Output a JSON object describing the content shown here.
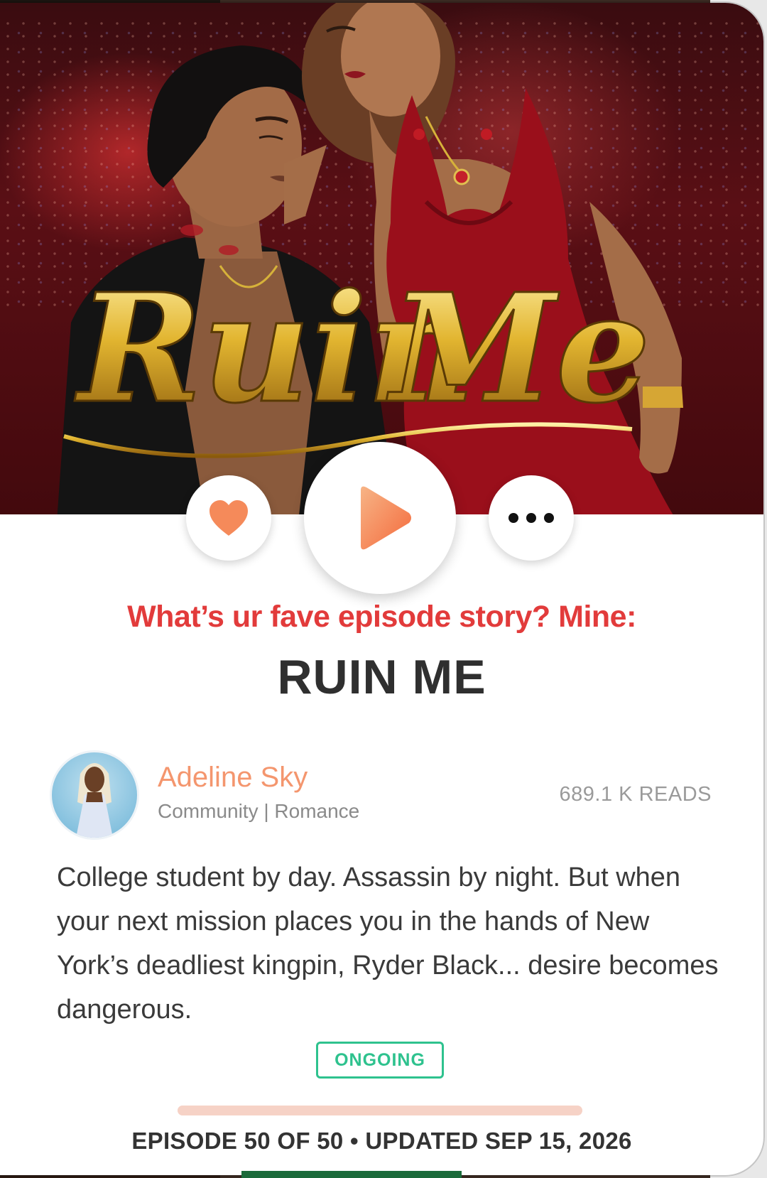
{
  "cover": {
    "title_art_text_1": "Ruin",
    "title_art_text_2": "Me"
  },
  "actions": {
    "like_icon": "heart-icon",
    "play_icon": "play-icon",
    "more_icon": "more-dots-icon"
  },
  "promo_text": "What’s ur fave episode story? Mine:",
  "story": {
    "title": "RUIN ME",
    "author": "Adeline Sky",
    "category": "Community | Romance",
    "reads": "689.1 K READS",
    "description": "College student by day. Assassin by night. But when your next mission places you in the hands of New York’s deadliest kingpin, Ryder Black... desire becomes dangerous.",
    "status": "ONGOING",
    "progress": 1.0,
    "episode_info": "EPISODE 50 OF 50 • UPDATED SEP 15, 2026"
  },
  "colors": {
    "accent": "#f4966e",
    "promo": "#e23b3b",
    "status": "#2ec28e",
    "title": "#2f2f2f"
  }
}
